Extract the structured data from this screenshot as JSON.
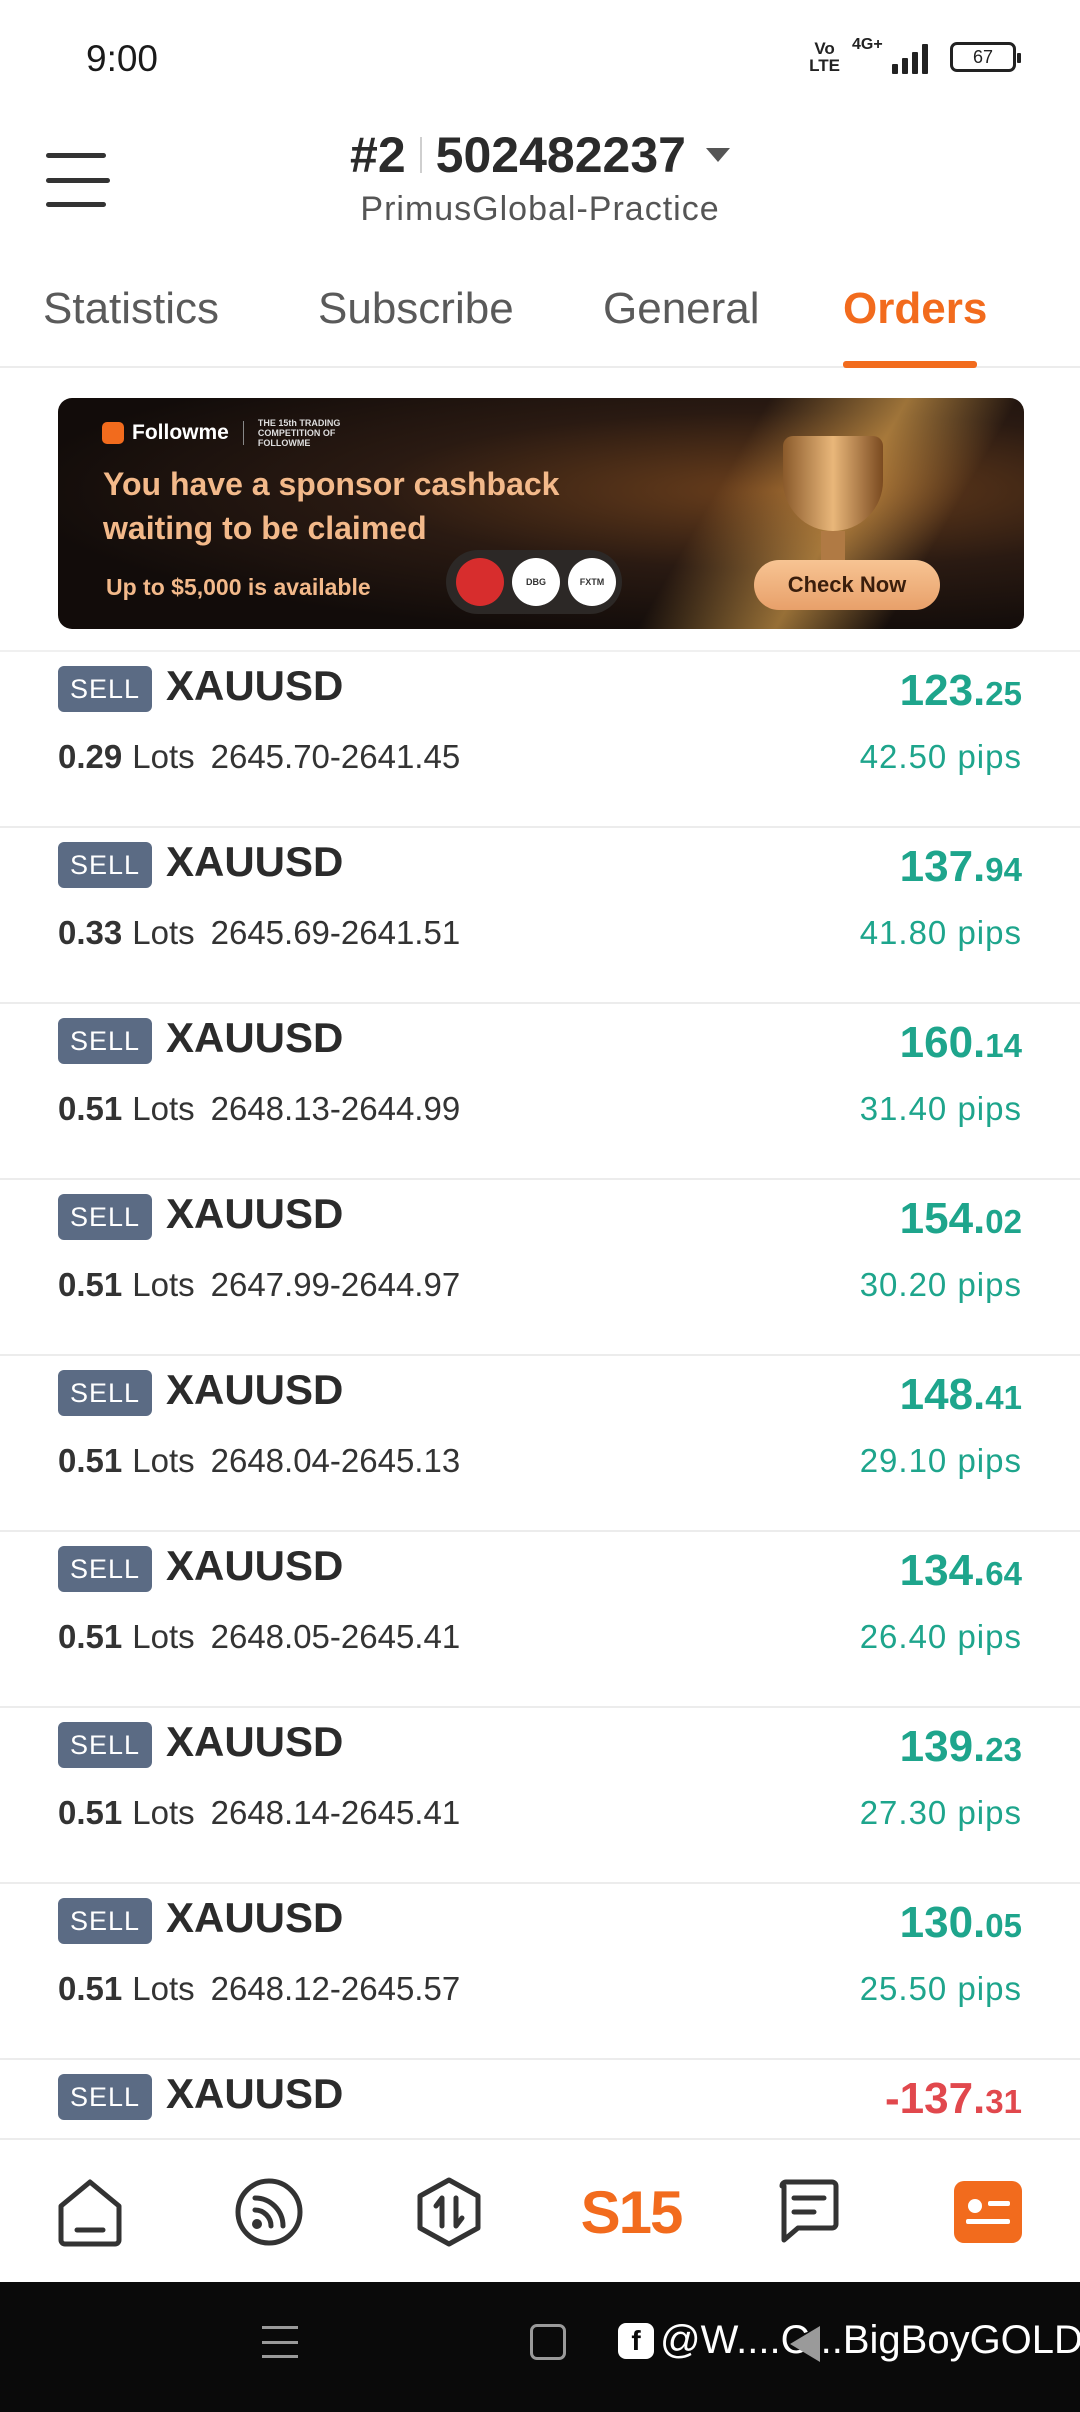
{
  "status_bar": {
    "time": "9:00",
    "volte": "Vo LTE",
    "network": "4G+",
    "battery": "67"
  },
  "header": {
    "account_rank": "#2",
    "account_number": "502482237",
    "server": "PrimusGlobal-Practice"
  },
  "tabs": [
    {
      "label": "Statistics",
      "active": false
    },
    {
      "label": "Subscribe",
      "active": false
    },
    {
      "label": "General",
      "active": false
    },
    {
      "label": "Orders",
      "active": true
    }
  ],
  "banner": {
    "brand": "Followme",
    "brand_sub": "THE 15th TRADING COMPETITION OF FOLLOWME",
    "headline": "You have a sponsor cashback waiting to be claimed",
    "footnote": "Up to $5,000 is available",
    "sponsors": [
      "",
      "DBG",
      "FXTM"
    ],
    "cta": "Check Now"
  },
  "orders": [
    {
      "side": "SELL",
      "symbol": "XAUUSD",
      "lots": "0.29",
      "lots_unit": "Lots",
      "prices": "2645.70-2641.45",
      "profit_int": "123.",
      "profit_dec": "25",
      "pips": "42.50 pips",
      "negative": false
    },
    {
      "side": "SELL",
      "symbol": "XAUUSD",
      "lots": "0.33",
      "lots_unit": "Lots",
      "prices": "2645.69-2641.51",
      "profit_int": "137.",
      "profit_dec": "94",
      "pips": "41.80 pips",
      "negative": false
    },
    {
      "side": "SELL",
      "symbol": "XAUUSD",
      "lots": "0.51",
      "lots_unit": "Lots",
      "prices": "2648.13-2644.99",
      "profit_int": "160.",
      "profit_dec": "14",
      "pips": "31.40 pips",
      "negative": false
    },
    {
      "side": "SELL",
      "symbol": "XAUUSD",
      "lots": "0.51",
      "lots_unit": "Lots",
      "prices": "2647.99-2644.97",
      "profit_int": "154.",
      "profit_dec": "02",
      "pips": "30.20 pips",
      "negative": false
    },
    {
      "side": "SELL",
      "symbol": "XAUUSD",
      "lots": "0.51",
      "lots_unit": "Lots",
      "prices": "2648.04-2645.13",
      "profit_int": "148.",
      "profit_dec": "41",
      "pips": "29.10 pips",
      "negative": false
    },
    {
      "side": "SELL",
      "symbol": "XAUUSD",
      "lots": "0.51",
      "lots_unit": "Lots",
      "prices": "2648.05-2645.41",
      "profit_int": "134.",
      "profit_dec": "64",
      "pips": "26.40 pips",
      "negative": false
    },
    {
      "side": "SELL",
      "symbol": "XAUUSD",
      "lots": "0.51",
      "lots_unit": "Lots",
      "prices": "2648.14-2645.41",
      "profit_int": "139.",
      "profit_dec": "23",
      "pips": "27.30 pips",
      "negative": false
    },
    {
      "side": "SELL",
      "symbol": "XAUUSD",
      "lots": "0.51",
      "lots_unit": "Lots",
      "prices": "2648.12-2645.57",
      "profit_int": "130.",
      "profit_dec": "05",
      "pips": "25.50 pips",
      "negative": false
    },
    {
      "side": "SELL",
      "symbol": "XAUUSD",
      "lots": "",
      "lots_unit": "",
      "prices": "",
      "profit_int": "-137.",
      "profit_dec": "31",
      "pips": "",
      "negative": true
    }
  ],
  "bottom_nav": {
    "items": [
      {
        "icon": "home-icon"
      },
      {
        "icon": "feed-icon"
      },
      {
        "icon": "trade-icon"
      },
      {
        "icon": "s15-competition-icon",
        "label": "S15"
      },
      {
        "icon": "message-icon"
      },
      {
        "icon": "profile-card-icon"
      }
    ]
  },
  "watermark": "@W....C...BigBoyGOLD",
  "colors": {
    "accent": "#f26b1d",
    "profit": "#1ea58c",
    "loss": "#e1484d",
    "badge": "#5b6b84"
  }
}
